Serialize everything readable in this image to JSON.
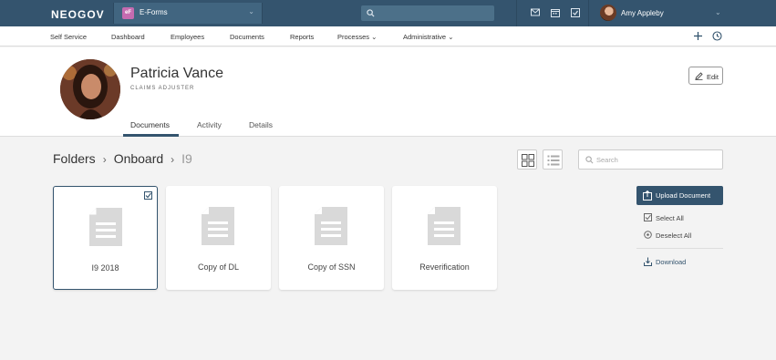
{
  "topbar": {
    "brand": "NEOGOV",
    "app_badge": "eF",
    "app_name": "E-Forms",
    "user_name": "Amy Appleby"
  },
  "nav": {
    "items": [
      "Self Service",
      "Dashboard",
      "Employees",
      "Documents",
      "Reports",
      "Processes",
      "Administrative"
    ]
  },
  "profile": {
    "name": "Patricia Vance",
    "role": "CLAIMS ADJUSTER",
    "edit_label": "Edit",
    "tabs": [
      "Documents",
      "Activity",
      "Details"
    ],
    "active_tab": "Documents"
  },
  "breadcrumb": [
    "Folders",
    "Onboard",
    "I9"
  ],
  "search": {
    "placeholder": "Search",
    "value": ""
  },
  "documents": [
    {
      "label": "I9 2018",
      "selected": true
    },
    {
      "label": "Copy of DL",
      "selected": false
    },
    {
      "label": "Copy of SSN",
      "selected": false
    },
    {
      "label": "Reverification",
      "selected": false
    }
  ],
  "actions": {
    "upload": "Upload Document",
    "select_all": "Select All",
    "deselect_all": "Deselect All",
    "download": "Download"
  },
  "colors": {
    "primary": "#34546e",
    "app_badge": "#c56bb0"
  }
}
